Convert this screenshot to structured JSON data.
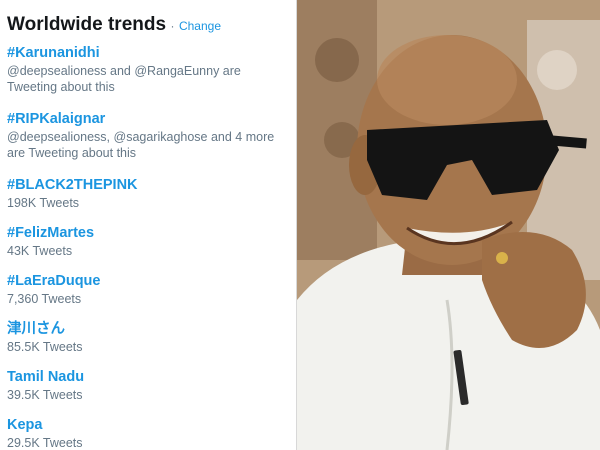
{
  "header": {
    "title": "Worldwide trends",
    "separator": "·",
    "change_label": "Change"
  },
  "trends": [
    {
      "name": "#Karunanidhi",
      "desc": "@deepsealioness and @RangaEunny are Tweeting about this"
    },
    {
      "name": "#RIPKalaignar",
      "desc": "@deepsealioness, @sagarikaghose and 4 more are Tweeting about this"
    },
    {
      "name": "#BLACK2THEPINK",
      "desc": "198K Tweets"
    },
    {
      "name": "#FelizMartes",
      "desc": "43K Tweets"
    },
    {
      "name": "#LaEraDuque",
      "desc": "7,360 Tweets"
    },
    {
      "name": "津川さん",
      "desc": "85.5K Tweets"
    },
    {
      "name": "Tamil Nadu",
      "desc": "39.5K Tweets"
    },
    {
      "name": "Kepa",
      "desc": "29.5K Tweets"
    }
  ],
  "colors": {
    "link_blue": "#1b95e0",
    "muted_gray": "#657786",
    "title_black": "#14171a"
  }
}
